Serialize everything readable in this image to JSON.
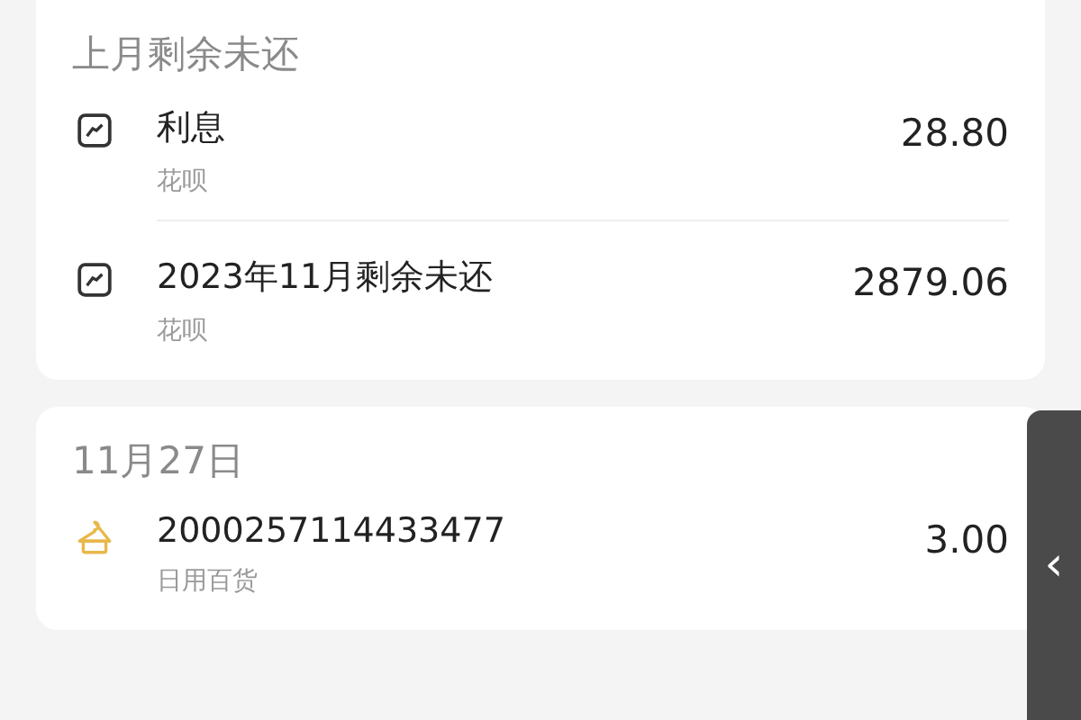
{
  "sections": [
    {
      "title": "上月剩余未还",
      "items": [
        {
          "kind": "chart",
          "title": "利息",
          "subtitle": "花呗",
          "amount": "28.80"
        },
        {
          "kind": "chart",
          "title": "2023年11月剩余未还",
          "subtitle": "花呗",
          "amount": "2879.06"
        }
      ]
    },
    {
      "title": "11月27日",
      "items": [
        {
          "kind": "hanger",
          "title": "2000257114433477",
          "subtitle": "日用百货",
          "amount": "3.00"
        }
      ]
    }
  ],
  "side_tab": {
    "glyph": "‹"
  }
}
